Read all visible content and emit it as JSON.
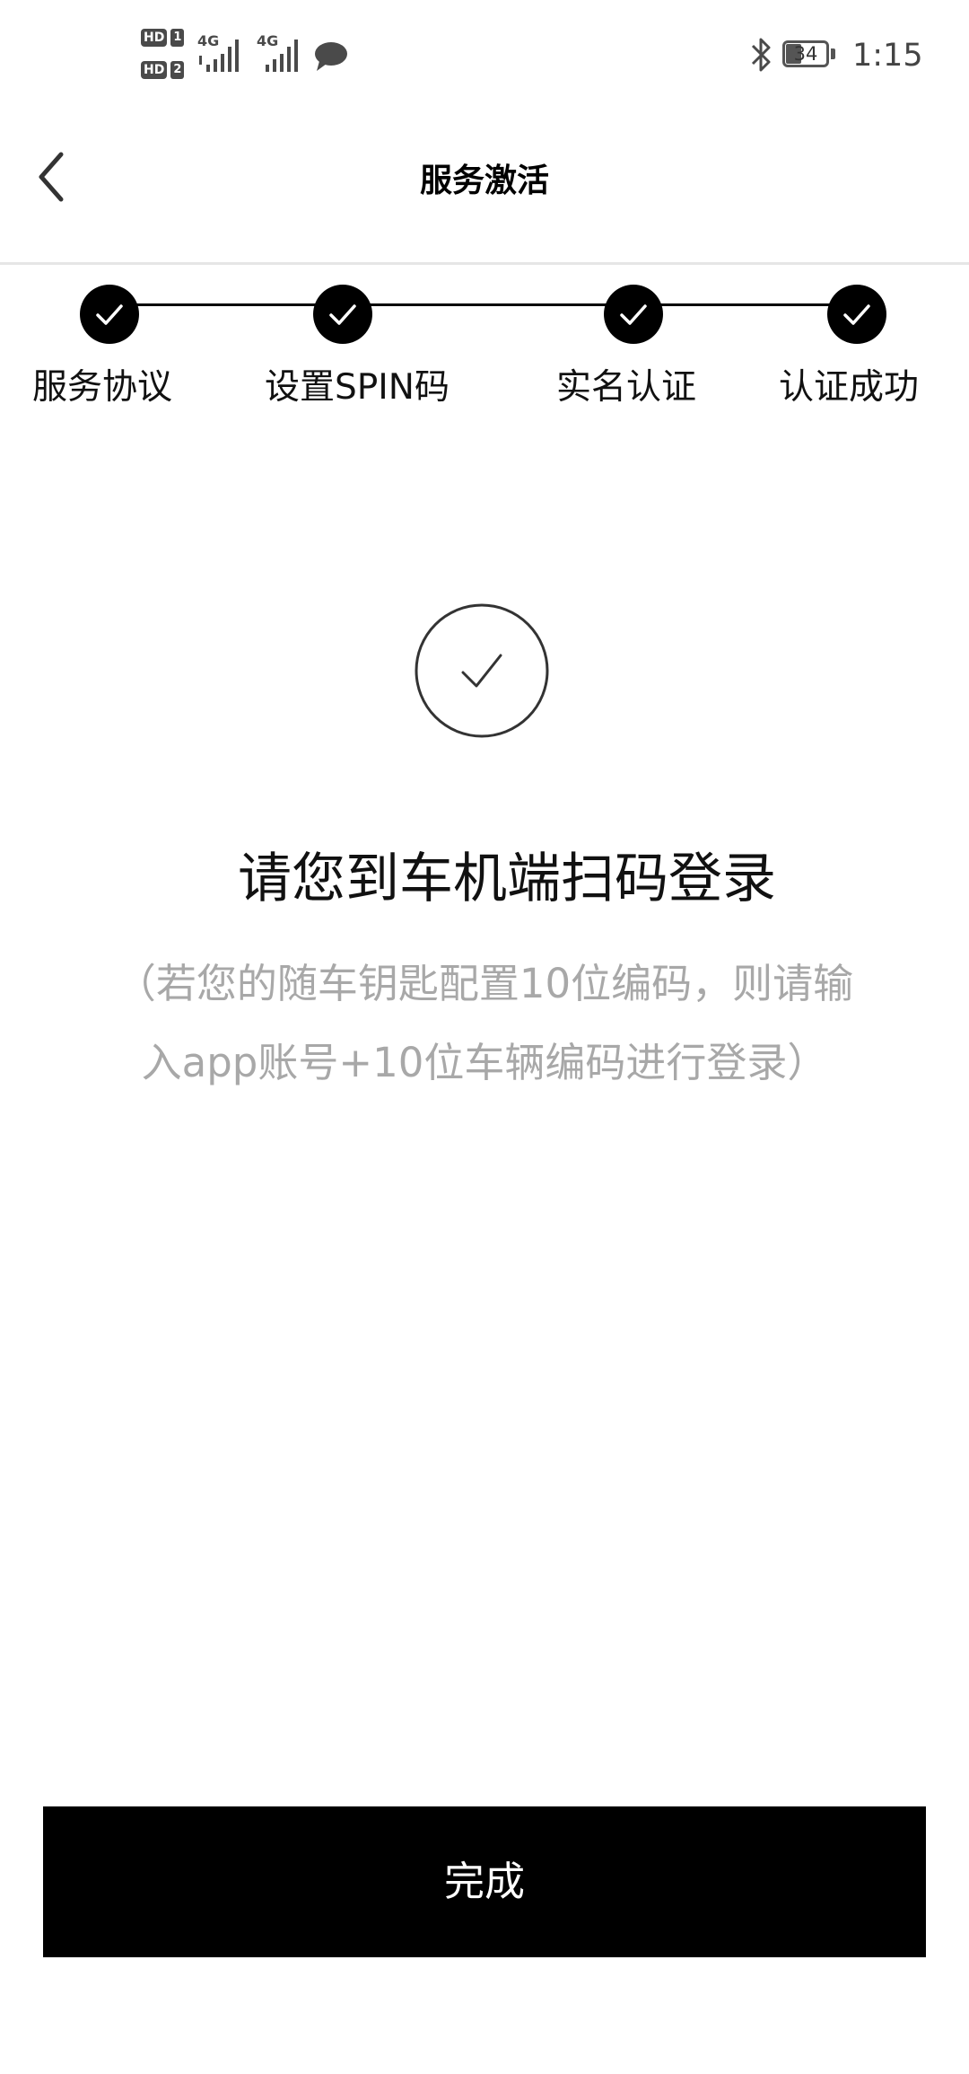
{
  "status_bar": {
    "sim1_badge": "HD",
    "sim1_slot": "1",
    "sim2_badge": "HD",
    "sim2_slot": "2",
    "net1": "4G",
    "net2": "4G",
    "battery_level": "34",
    "time": "1:15",
    "icons": [
      "signal-icon",
      "chat-bubble-icon",
      "bluetooth-icon",
      "battery-icon"
    ]
  },
  "nav": {
    "title": "服务激活",
    "back_icon": "chevron-left-icon"
  },
  "stepper": {
    "steps": [
      {
        "label": "服务协议",
        "status": "done"
      },
      {
        "label": "设置SPIN码",
        "status": "done"
      },
      {
        "label": "实名认证",
        "status": "done"
      },
      {
        "label": "认证成功",
        "status": "done"
      }
    ]
  },
  "result": {
    "icon": "check-circle-icon",
    "headline": "请您到车机端扫码登录",
    "hint_line1": "（若您的随车钥匙配置10位编码，则请输",
    "hint_line2": "入app账号+10位车辆编码进行登录）"
  },
  "footer": {
    "finish_label": "完成"
  },
  "colors": {
    "primary": "#000000",
    "background": "#ffffff",
    "hint": "#a8a8a8",
    "divider": "#e6e6e6"
  }
}
